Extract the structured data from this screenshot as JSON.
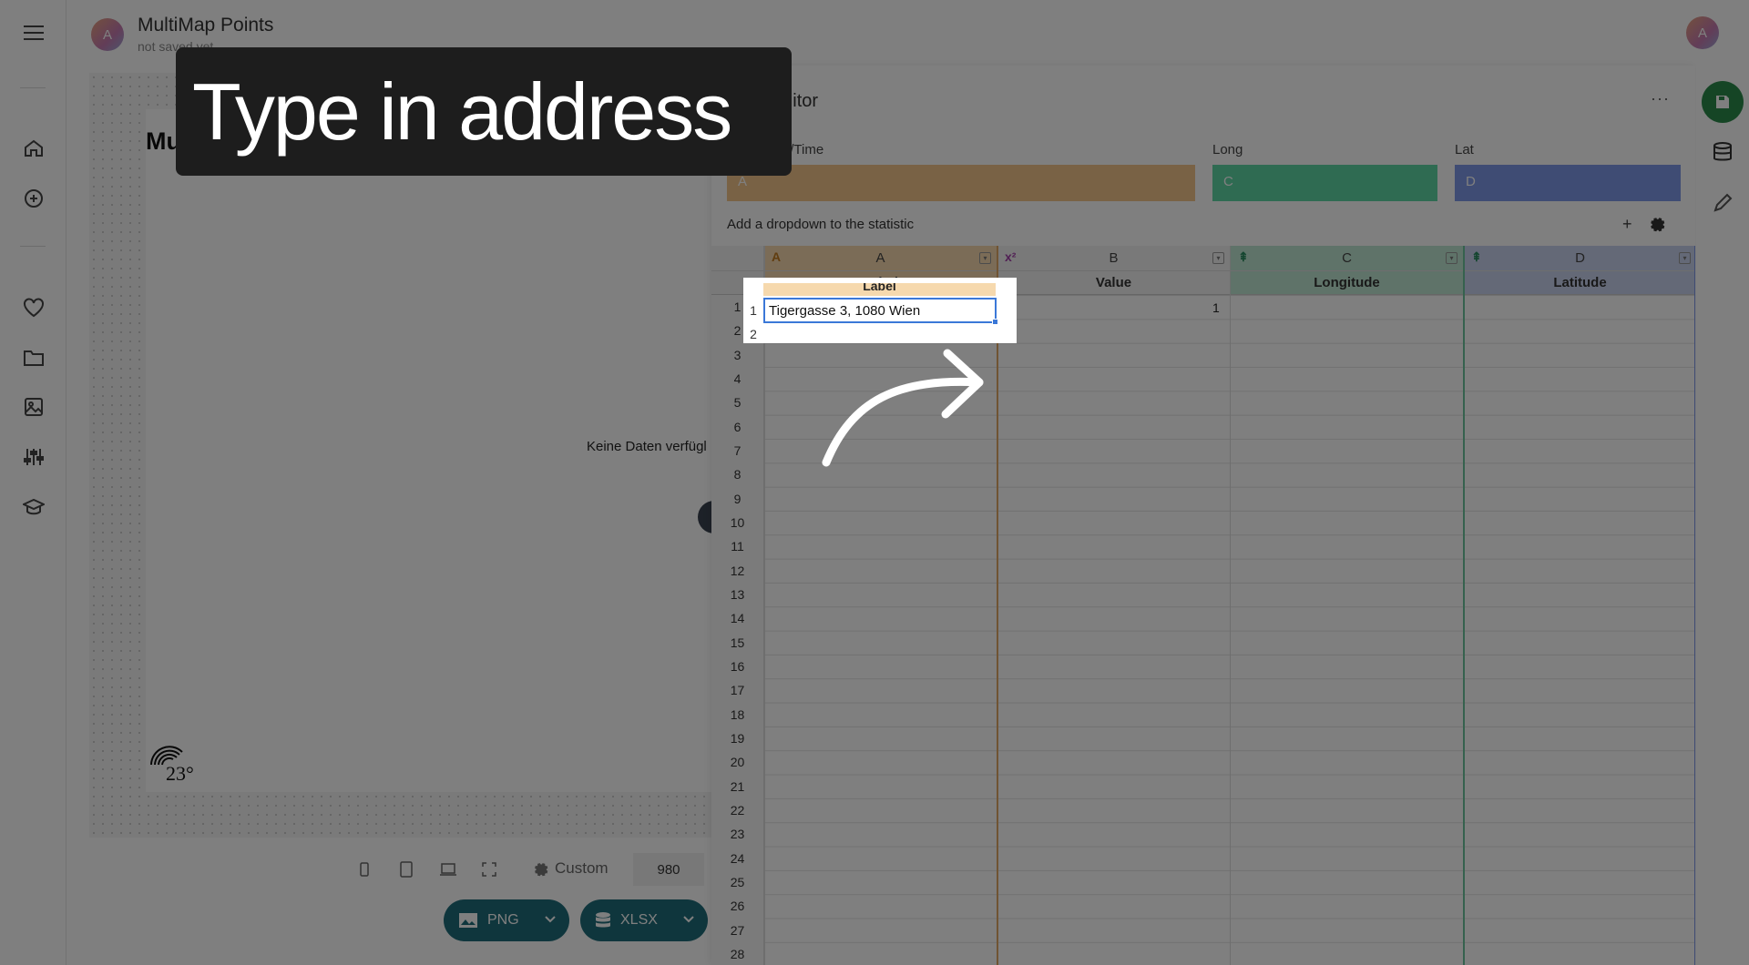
{
  "app": {
    "avatar_letter": "A",
    "title": "MultiMap Points",
    "subtitle": "not saved yet"
  },
  "nav": {
    "items": [
      "menu-icon",
      "home-icon",
      "add-circle-icon",
      "heart-icon",
      "folder-icon",
      "image-icon",
      "sliders-icon",
      "graduation-cap-icon"
    ]
  },
  "preview": {
    "title": "MultiMap Points",
    "empty_text": "Keine Daten verfügl",
    "logo_text": "23°"
  },
  "bottom_toolbar": {
    "custom_label": "Custom",
    "width_value": "980",
    "png_label": "PNG",
    "xlsx_label": "XLSX"
  },
  "caption": {
    "text": "Type in address"
  },
  "editor": {
    "title": "Data Editor",
    "more": "···",
    "mapping": [
      {
        "label": "Label/Geo/Time",
        "value": "A",
        "color": "#c9a675"
      },
      {
        "label": "Long",
        "value": "C",
        "color": "#4aa27e"
      },
      {
        "label": "Lat",
        "value": "D",
        "color": "#5c71b8"
      }
    ],
    "dropdown_label": "Add a dropdown to the statistic",
    "plus": "+",
    "columns": [
      {
        "letter": "A",
        "header": "Label",
        "type_glyph": "A"
      },
      {
        "letter": "B",
        "header": "Value",
        "type_glyph": "x²"
      },
      {
        "letter": "C",
        "header": "Longitude",
        "type_glyph": "⇞"
      },
      {
        "letter": "D",
        "header": "Latitude",
        "type_glyph": "⇞"
      }
    ],
    "row_numbers": [
      "1",
      "2",
      "3",
      "4",
      "5",
      "6",
      "7",
      "8",
      "9",
      "10",
      "11",
      "12",
      "13",
      "14",
      "15",
      "16",
      "17",
      "18",
      "19",
      "20",
      "21",
      "22",
      "23",
      "24",
      "25",
      "26",
      "27",
      "28"
    ],
    "cells": {
      "a1": "Tigergasse 3, 1080 Wien",
      "b1": "1"
    }
  },
  "colors": {
    "label_col": "#f6d9ae",
    "long_col": "#bfe6d3",
    "lat_col": "#c9d2ef",
    "accent_green": "#2a8a4a",
    "export_teal": "#1f6d7a"
  }
}
